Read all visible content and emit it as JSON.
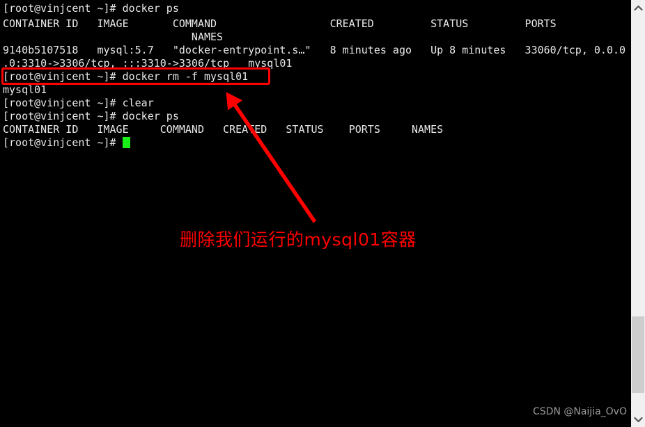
{
  "terminal": {
    "background_color": "#000000",
    "text_color": "#e8e8e8",
    "cursor_color": "#18f018",
    "lines": [
      {
        "id": "l1",
        "text": "[root@vinjcent ~]# docker ps"
      },
      {
        "id": "l2",
        "text": "CONTAINER ID   IMAGE       COMMAND                  CREATED         STATUS         PORTS"
      },
      {
        "id": "l3",
        "text": "                              NAMES"
      },
      {
        "id": "l4",
        "text": "9140b5107518   mysql:5.7   \"docker-entrypoint.s…\"   8 minutes ago   Up 8 minutes   33060/tcp, 0.0.0"
      },
      {
        "id": "l5",
        "text": ".0:3310->3306/tcp, :::3310->3306/tcp   mysql01"
      },
      {
        "id": "l6",
        "text": "[root@vinjcent ~]# docker rm -f mysql01"
      },
      {
        "id": "l7",
        "text": "mysql01"
      },
      {
        "id": "l8",
        "text": "[root@vinjcent ~]# clear"
      },
      {
        "id": "l9",
        "text": "[root@vinjcent ~]# docker ps"
      },
      {
        "id": "l10",
        "text": "CONTAINER ID   IMAGE     COMMAND   CREATED   STATUS    PORTS     NAMES"
      },
      {
        "id": "l11",
        "text": "[root@vinjcent ~]# "
      }
    ],
    "commands": {
      "docker_ps": "docker ps",
      "docker_rm": "docker rm -f mysql01",
      "clear": "clear"
    },
    "prompt": "[root@vinjcent ~]#",
    "container": {
      "id": "9140b5107518",
      "image": "mysql:5.7",
      "command": "\"docker-entrypoint.s…\"",
      "created": "8 minutes ago",
      "status": "Up 8 minutes",
      "ports": "33060/tcp, 0.0.0.0:3310->3306/tcp, :::3310->3306/tcp",
      "names": "mysql01"
    },
    "table_headers": [
      "CONTAINER ID",
      "IMAGE",
      "COMMAND",
      "CREATED",
      "STATUS",
      "PORTS",
      "NAMES"
    ]
  },
  "annotation": {
    "highlight_color": "#ff0000",
    "text": "删除我们运行的mysql01容器",
    "arrow_color": "#ff0000"
  },
  "watermark": {
    "text": "CSDN @Naijia_OvO",
    "color": "#9b9b9b"
  },
  "scrollbar": {
    "track_color": "#f0f0f0",
    "thumb_color": "#cdcdcd",
    "up_arrow_icon": "chevron-up-icon",
    "down_arrow_icon": "chevron-down-icon"
  }
}
